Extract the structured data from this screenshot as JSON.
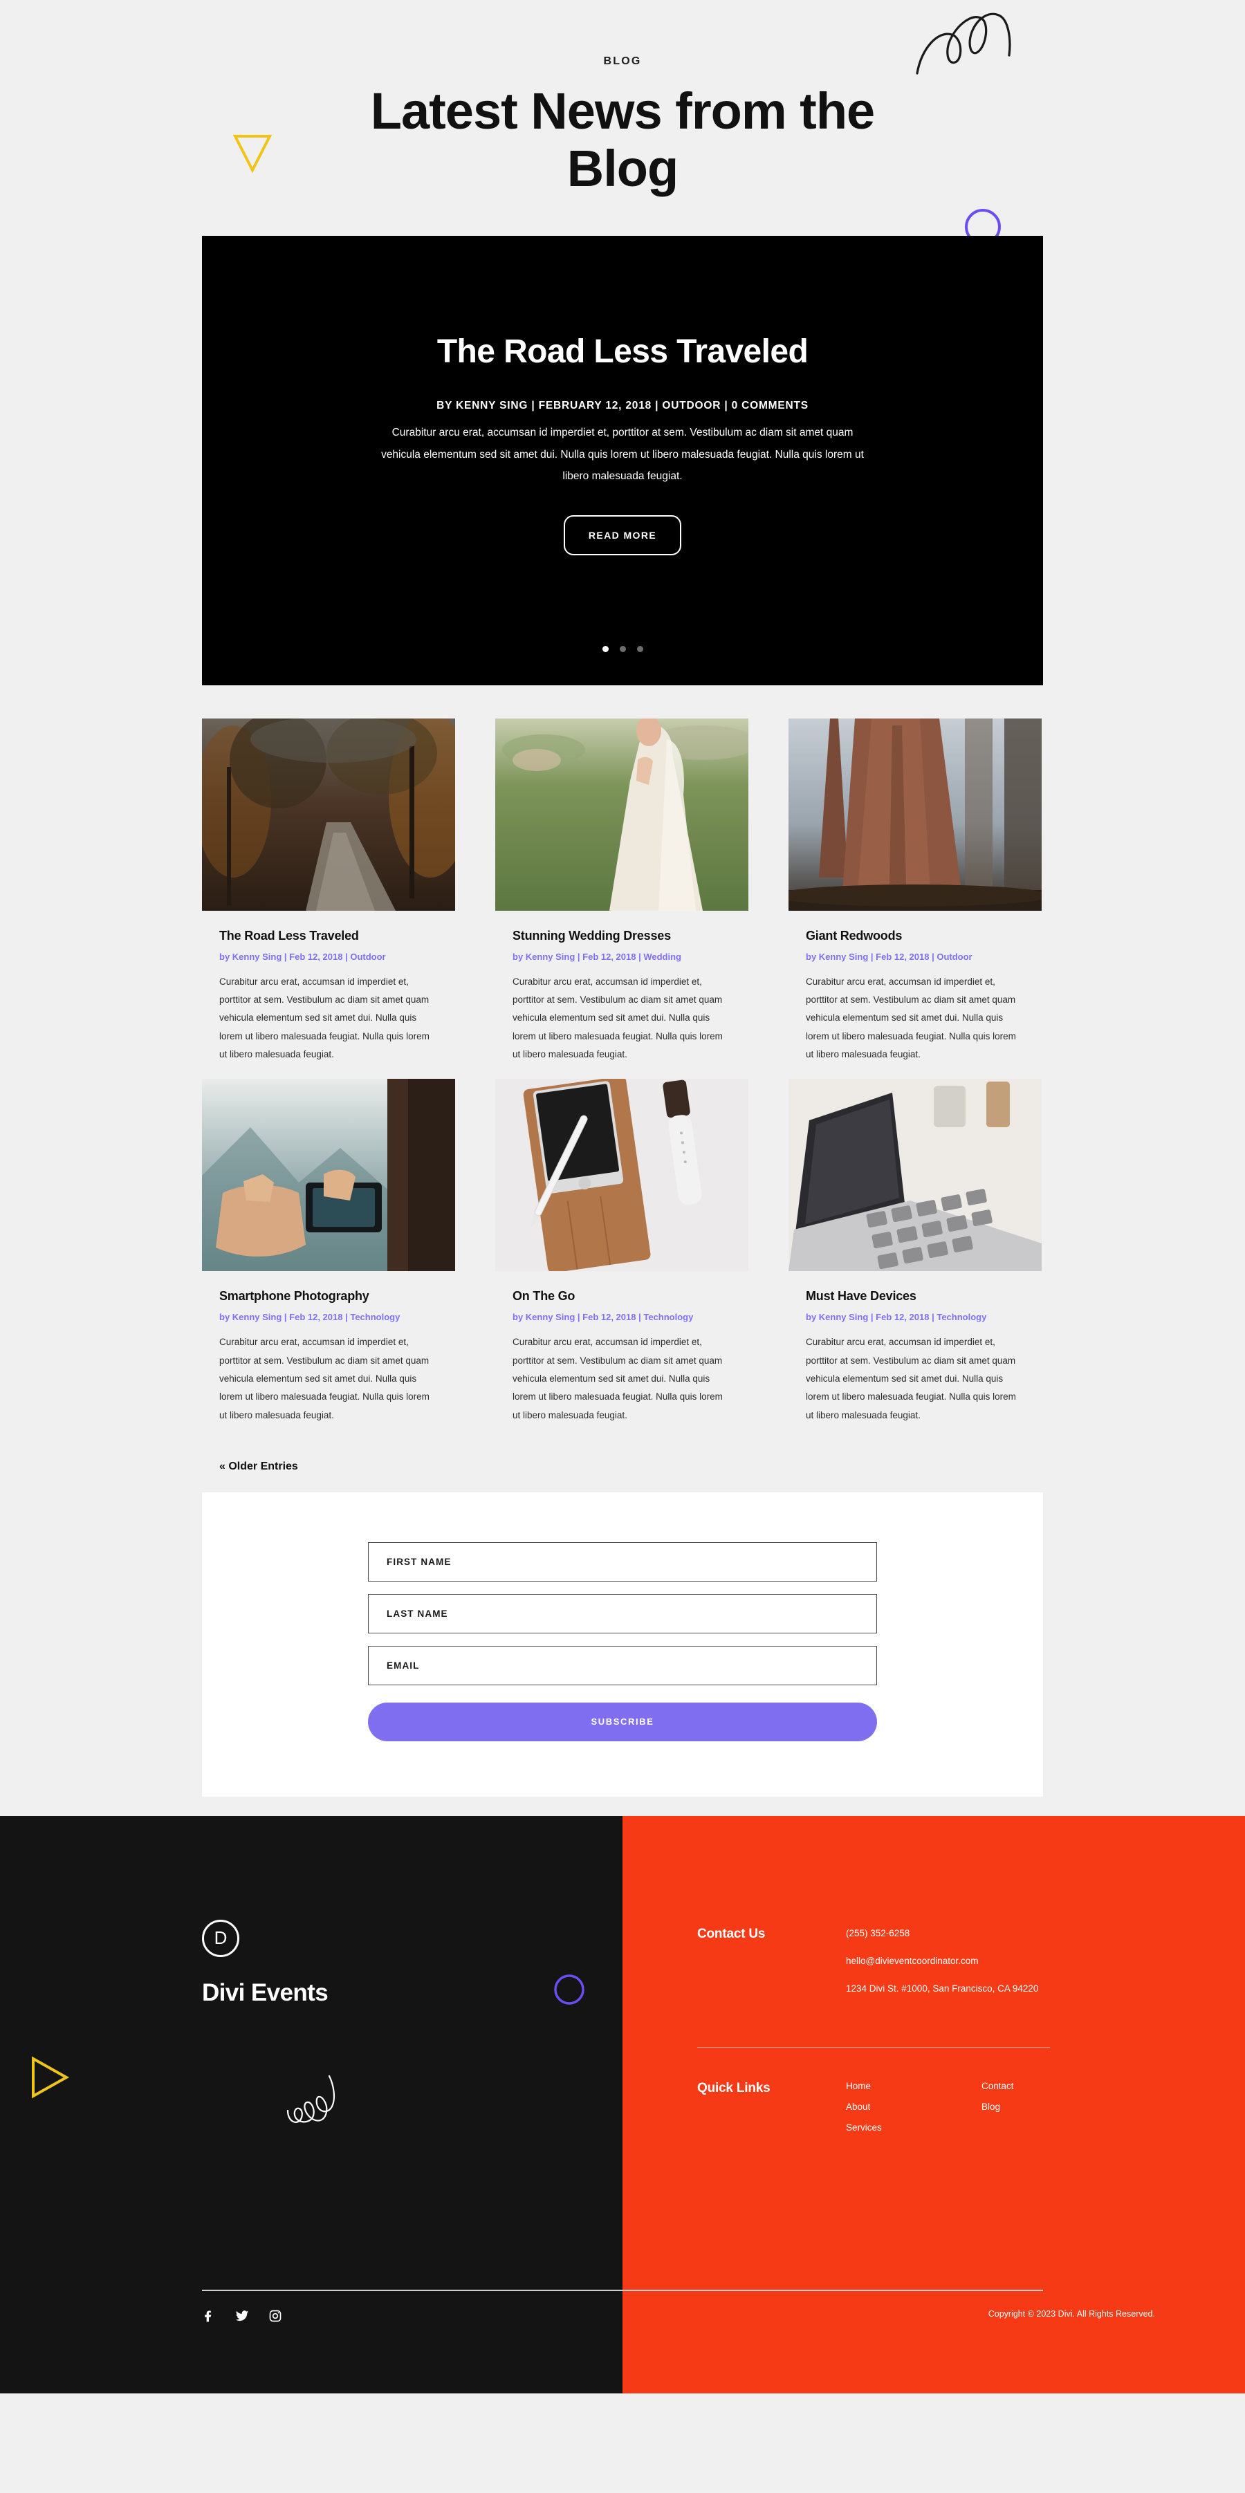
{
  "header": {
    "eyebrow": "BLOG",
    "title": "Latest News from the Blog"
  },
  "slider": {
    "title": "The Road Less Traveled",
    "meta": "BY KENNY SING | FEBRUARY 12, 2018 | OUTDOOR | 0 COMMENTS",
    "excerpt": "Curabitur arcu erat, accumsan id imperdiet et, porttitor at sem. Vestibulum ac diam sit amet quam vehicula elementum sed sit amet dui. Nulla quis lorem ut libero malesuada feugiat. Nulla quis lorem ut libero malesuada feugiat.",
    "button_label": "READ MORE",
    "dots": 3,
    "active_dot": 0
  },
  "blog": {
    "older_entries_label": "« Older Entries",
    "posts": [
      {
        "title": "The Road Less Traveled",
        "meta": "by Kenny Sing | Feb 12, 2018 | Outdoor",
        "excerpt": "Curabitur arcu erat, accumsan id imperdiet et, porttitor at sem. Vestibulum ac diam sit amet quam vehicula elementum sed sit amet dui. Nulla quis lorem ut libero malesuada feugiat. Nulla quis lorem ut libero malesuada feugiat.",
        "image_name": "autumn-forest-road-photo"
      },
      {
        "title": "Stunning Wedding Dresses",
        "meta": "by Kenny Sing | Feb 12, 2018 | Wedding",
        "excerpt": "Curabitur arcu erat, accumsan id imperdiet et, porttitor at sem. Vestibulum ac diam sit amet quam vehicula elementum sed sit amet dui. Nulla quis lorem ut libero malesuada feugiat. Nulla quis lorem ut libero malesuada feugiat.",
        "image_name": "bride-in-wedding-dress-photo"
      },
      {
        "title": "Giant Redwoods",
        "meta": "by Kenny Sing | Feb 12, 2018 | Outdoor",
        "excerpt": "Curabitur arcu erat, accumsan id imperdiet et, porttitor at sem. Vestibulum ac diam sit amet quam vehicula elementum sed sit amet dui. Nulla quis lorem ut libero malesuada feugiat. Nulla quis lorem ut libero malesuada feugiat.",
        "image_name": "giant-redwood-trees-photo"
      },
      {
        "title": "Smartphone Photography",
        "meta": "by Kenny Sing | Feb 12, 2018 | Technology",
        "excerpt": "Curabitur arcu erat, accumsan id imperdiet et, porttitor at sem. Vestibulum ac diam sit amet quam vehicula elementum sed sit amet dui. Nulla quis lorem ut libero malesuada feugiat. Nulla quis lorem ut libero malesuada feugiat.",
        "image_name": "hands-holding-phone-mountain-photo"
      },
      {
        "title": "On The Go",
        "meta": "by Kenny Sing | Feb 12, 2018 | Technology",
        "excerpt": "Curabitur arcu erat, accumsan id imperdiet et, porttitor at sem. Vestibulum ac diam sit amet quam vehicula elementum sed sit amet dui. Nulla quis lorem ut libero malesuada feugiat. Nulla quis lorem ut libero malesuada feugiat.",
        "image_name": "tablet-stylus-leather-case-photo"
      },
      {
        "title": "Must Have Devices",
        "meta": "by Kenny Sing | Feb 12, 2018 | Technology",
        "excerpt": "Curabitur arcu erat, accumsan id imperdiet et, porttitor at sem. Vestibulum ac diam sit amet quam vehicula elementum sed sit amet dui. Nulla quis lorem ut libero malesuada feugiat. Nulla quis lorem ut libero malesuada feugiat.",
        "image_name": "laptop-keyboard-desk-photo"
      }
    ]
  },
  "subscribe": {
    "first_name_placeholder": "FIRST NAME",
    "first_name_value": "",
    "last_name_placeholder": "LAST NAME",
    "last_name_value": "",
    "email_placeholder": "EMAIL",
    "email_value": "",
    "button_label": "SUBSCRIBE"
  },
  "footer": {
    "logo_letter": "D",
    "logo_text": "Divi Events",
    "contact_heading": "Contact Us",
    "contact_lines": [
      "(255) 352-6258",
      "hello@divieventcoordinator.com",
      "1234 Divi St. #1000, San Francisco, CA 94220"
    ],
    "quick_links_heading": "Quick Links",
    "links_col1": [
      "Home",
      "About",
      "Services"
    ],
    "links_col2": [
      "Contact",
      "Blog"
    ],
    "social": [
      "facebook-icon",
      "twitter-icon",
      "instagram-icon"
    ],
    "copyright": "Copyright © 2023 Divi. All Rights Reserved."
  },
  "colors": {
    "page_background": "#f0f0f0",
    "slider_background": "#000000",
    "accent_purple": "#7f6ef0",
    "meta_purple": "#7f70f3",
    "footer_dark": "#141414",
    "footer_red": "#f53a15",
    "deco_yellow": "#f0c419",
    "deco_purple": "#6c4ef0"
  }
}
